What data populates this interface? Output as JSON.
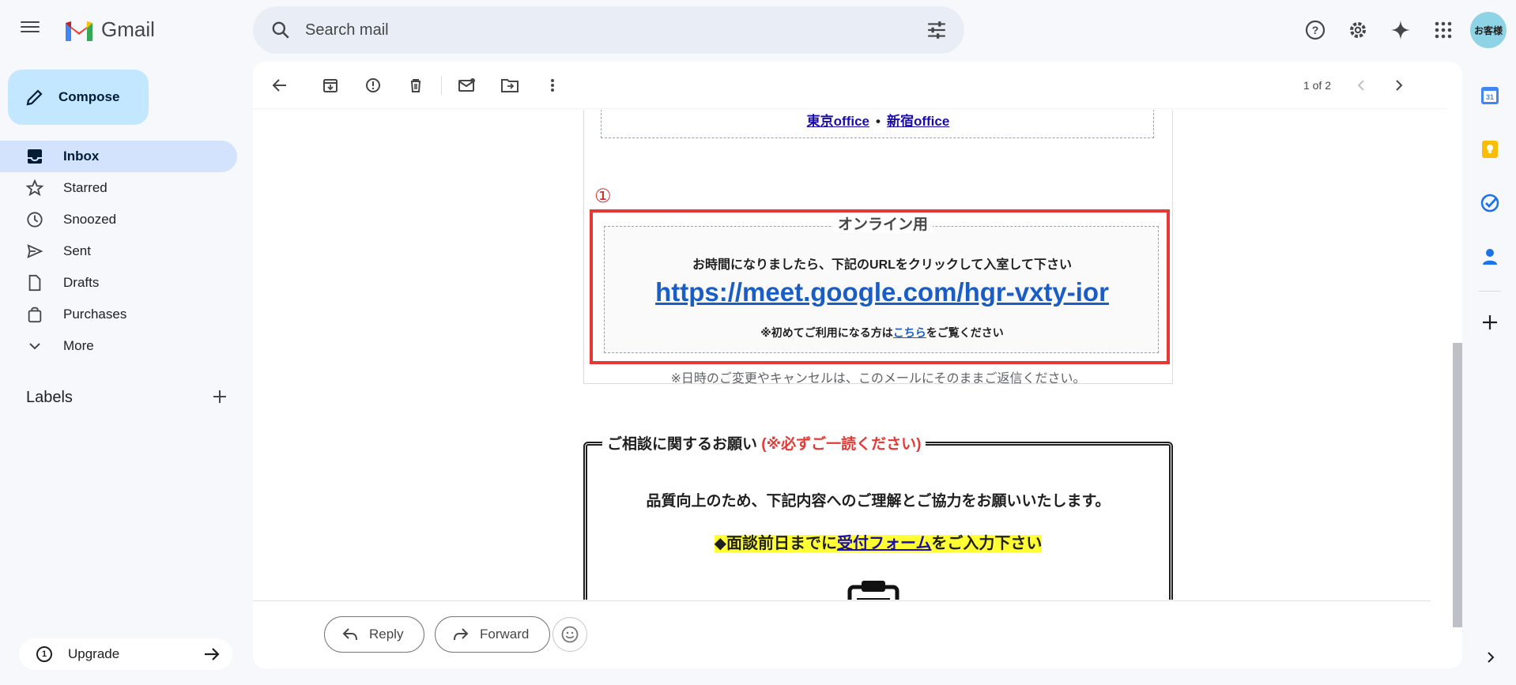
{
  "app": {
    "name": "Gmail"
  },
  "search": {
    "placeholder": "Search mail"
  },
  "header": {
    "avatar_text": "お客様"
  },
  "compose": {
    "label": "Compose"
  },
  "sidebar": {
    "items": [
      {
        "label": "Inbox",
        "icon": "inbox-icon",
        "active": true
      },
      {
        "label": "Starred",
        "icon": "star-icon"
      },
      {
        "label": "Snoozed",
        "icon": "clock-icon"
      },
      {
        "label": "Sent",
        "icon": "send-icon"
      },
      {
        "label": "Drafts",
        "icon": "draft-icon"
      },
      {
        "label": "Purchases",
        "icon": "shopping-bag-icon"
      },
      {
        "label": "More",
        "icon": "chevron-down-icon"
      }
    ],
    "labels_heading": "Labels",
    "upgrade_label": "Upgrade"
  },
  "toolbar": {
    "pager": "1 of 2"
  },
  "email": {
    "office_link_1": "東京office",
    "office_separator": "•",
    "office_link_2": "新宿office",
    "marker": "①",
    "online_title": "オンライン用",
    "online_line1": "お時間になりましたら、下記のURLをクリックして入室して下さい",
    "meet_url": "https://meet.google.com/hgr-vxty-ior",
    "first_time_prefix": "※初めてご利用になる方は",
    "first_time_link": "こちら",
    "first_time_suffix": "をご覧ください",
    "change_note": "※日時のご変更やキャンセルは、このメールにそのままご返信ください。",
    "consult_title": "ご相談に関するお願い",
    "consult_title_red": "(※必ずご一読ください)",
    "consult_line1": "品質向上のため、下記内容へのご理解とご協力をお願いいたします。",
    "consult_line2_prefix": "◆面談前日までに",
    "consult_line2_link": "受付フォーム",
    "consult_line2_suffix": "をご入力下さい"
  },
  "reply_bar": {
    "reply_label": "Reply",
    "forward_label": "Forward"
  },
  "colors": {
    "accent": "#c2e7ff",
    "active_nav": "#d3e3fd",
    "alert_red": "#e53935",
    "link_blue": "#1a5dc5",
    "highlight": "#ffff33"
  }
}
